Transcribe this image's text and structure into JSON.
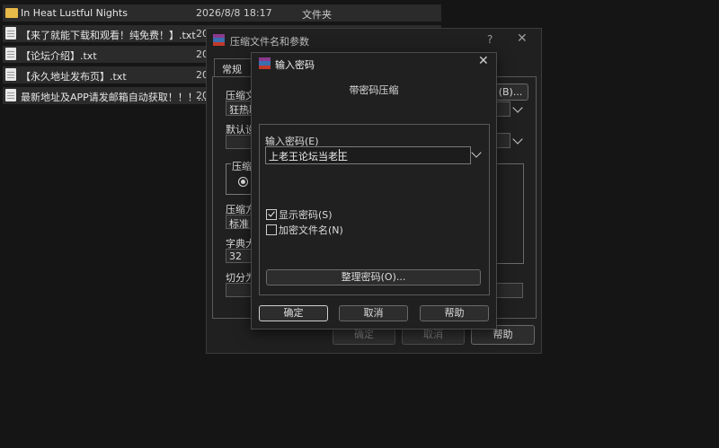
{
  "files": [
    {
      "name": "In Heat Lustful Nights",
      "date": "2026/8/8 18:17",
      "type": "文件夹",
      "icon": "folder-icon"
    },
    {
      "name": "【来了就能下载和观看！纯免费！】.txt",
      "date": "20",
      "type": "",
      "icon": "text-file-icon"
    },
    {
      "name": "【论坛介绍】.txt",
      "date": "20",
      "type": "",
      "icon": "text-file-icon"
    },
    {
      "name": "【永久地址发布页】.txt",
      "date": "20",
      "type": "",
      "icon": "text-file-icon"
    },
    {
      "name": "最新地址及APP请发邮箱自动获取！！！....",
      "date": "20",
      "type": "",
      "icon": "text-file-icon"
    }
  ],
  "archive_dialog": {
    "title": "压缩文件名和参数",
    "help": "?",
    "close": "✕",
    "tab_general": "常规",
    "archive_name_label": "压缩文",
    "archive_name_value": "狂热取",
    "browse_button": "(B)...",
    "default_label": "默认设",
    "format_label": "压缩文",
    "method_label": "压缩方",
    "method_value": "标准",
    "dict_label": "字典大",
    "dict_value": "32",
    "split_label": "切分为",
    "ok": "确定",
    "cancel": "取消",
    "help_button": "帮助"
  },
  "password_dialog": {
    "title": "输入密码",
    "close": "✕",
    "heading": "带密码压缩",
    "enter_label": "输入密码(E)",
    "password_value": "上老王论坛当老王",
    "show_password": "显示密码(S)",
    "show_password_checked": true,
    "encrypt_names": "加密文件名(N)",
    "encrypt_names_checked": false,
    "organize_button": "整理密码(O)...",
    "ok": "确定",
    "cancel": "取消",
    "help": "帮助"
  }
}
